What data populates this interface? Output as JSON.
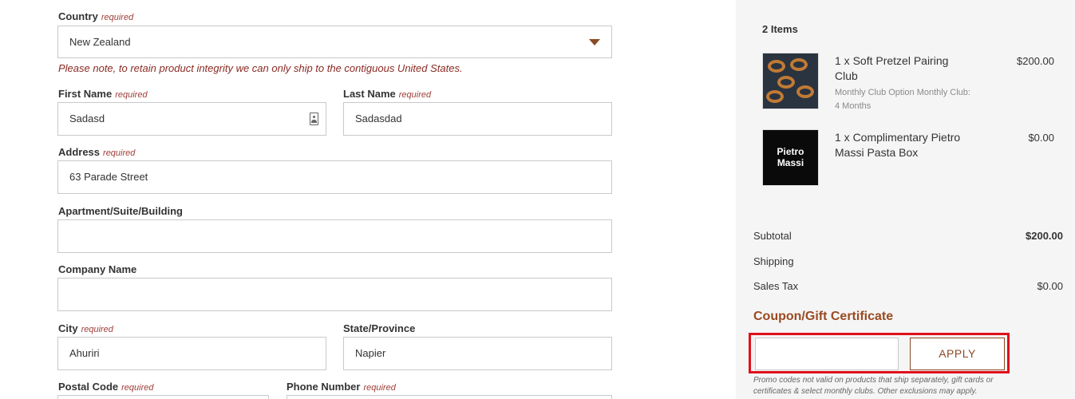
{
  "form": {
    "required_text": "required",
    "country": {
      "label": "Country",
      "value": "New Zealand"
    },
    "notice": "Please note, to retain product integrity we can only ship to the contiguous United States.",
    "first_name": {
      "label": "First Name",
      "value": "Sadasd"
    },
    "last_name": {
      "label": "Last Name",
      "value": "Sadasdad"
    },
    "address": {
      "label": "Address",
      "value": "63 Parade Street"
    },
    "apartment": {
      "label": "Apartment/Suite/Building",
      "value": ""
    },
    "company": {
      "label": "Company Name",
      "value": ""
    },
    "city": {
      "label": "City",
      "value": "Ahuriri"
    },
    "state": {
      "label": "State/Province",
      "value": "Napier"
    },
    "postal_code": {
      "label": "Postal Code",
      "value": ""
    },
    "phone": {
      "label": "Phone Number",
      "value": ""
    }
  },
  "summary": {
    "items_count": "2 Items",
    "items": [
      {
        "name": "1 x Soft Pretzel Pairing Club",
        "options": "Monthly Club Option Monthly Club: 4 Months",
        "price": "$200.00",
        "image_icon": "pretzel-product-icon"
      },
      {
        "name": "1 x Complimentary Pietro Massi Pasta Box",
        "options": "",
        "price": "$0.00",
        "image_text": "Pietro Massi",
        "image_icon": "pasta-box-product-icon"
      }
    ],
    "subtotal": {
      "label": "Subtotal",
      "value": "$200.00"
    },
    "shipping": {
      "label": "Shipping",
      "value": ""
    },
    "sales_tax": {
      "label": "Sales Tax",
      "value": "$0.00"
    }
  },
  "coupon": {
    "title": "Coupon/Gift Certificate",
    "input_value": "",
    "apply_label": "APPLY",
    "note": "Promo codes not valid on products that ship separately, gift cards or certificates & select monthly clubs. Other exclusions may apply."
  },
  "colors": {
    "accent": "#8a4a24",
    "required": "#a0403a",
    "highlight": "#e0101a",
    "panel_bg": "#f5f5f5"
  }
}
